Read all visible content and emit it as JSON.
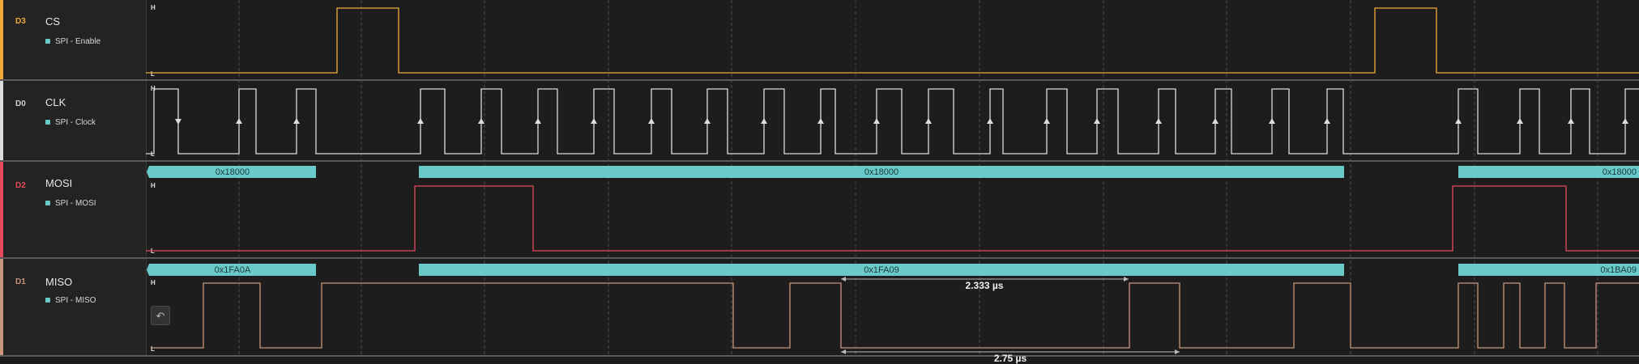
{
  "channels": [
    {
      "id": "D3",
      "name": "CS",
      "analyzer": "SPI - Enable",
      "color": "#f2a93b"
    },
    {
      "id": "D0",
      "name": "CLK",
      "analyzer": "SPI - Clock",
      "color": "#dcdcdc"
    },
    {
      "id": "D2",
      "name": "MOSI",
      "analyzer": "SPI - MOSI",
      "color": "#e8475c"
    },
    {
      "id": "D1",
      "name": "MISO",
      "analyzer": "SPI - MISO",
      "color": "#c9957a"
    }
  ],
  "level_labels": {
    "high": "H",
    "low": "L"
  },
  "mosi_frames": [
    "0x18000",
    "0x18000",
    "0x18000"
  ],
  "miso_frames": [
    "0x1FA0A",
    "0x1FA09",
    "0x1BA09"
  ],
  "measurements": [
    "2.333 µs",
    "2.75 µs"
  ],
  "undo_icon": "↶",
  "colors": {
    "background": "#1d1d1d",
    "frame_fill": "#6ac9c9",
    "frame_text": "#1a3a3a",
    "grid": "#4a4a4a"
  }
}
